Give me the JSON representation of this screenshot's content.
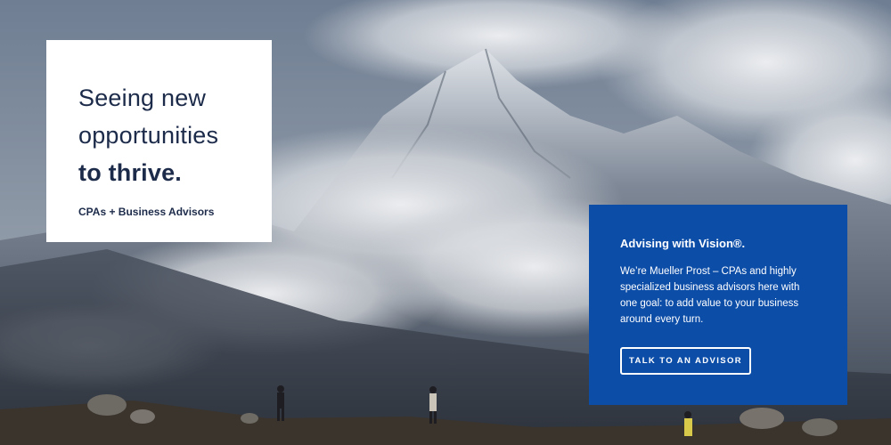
{
  "headline": {
    "line1": "Seeing new",
    "line2": "opportunities",
    "line3": "to thrive.",
    "subtitle": "CPAs + Business Advisors"
  },
  "vision": {
    "title": "Advising with Vision®.",
    "body": "We’re Mueller Prost – CPAs and highly specialized business advisors here with one goal: to add value to your business around every turn.",
    "cta_label": "TALK TO AN ADVISOR"
  },
  "colors": {
    "brand_blue": "#0c4da8",
    "headline_navy": "#1d2b4a",
    "card_white": "#ffffff"
  }
}
